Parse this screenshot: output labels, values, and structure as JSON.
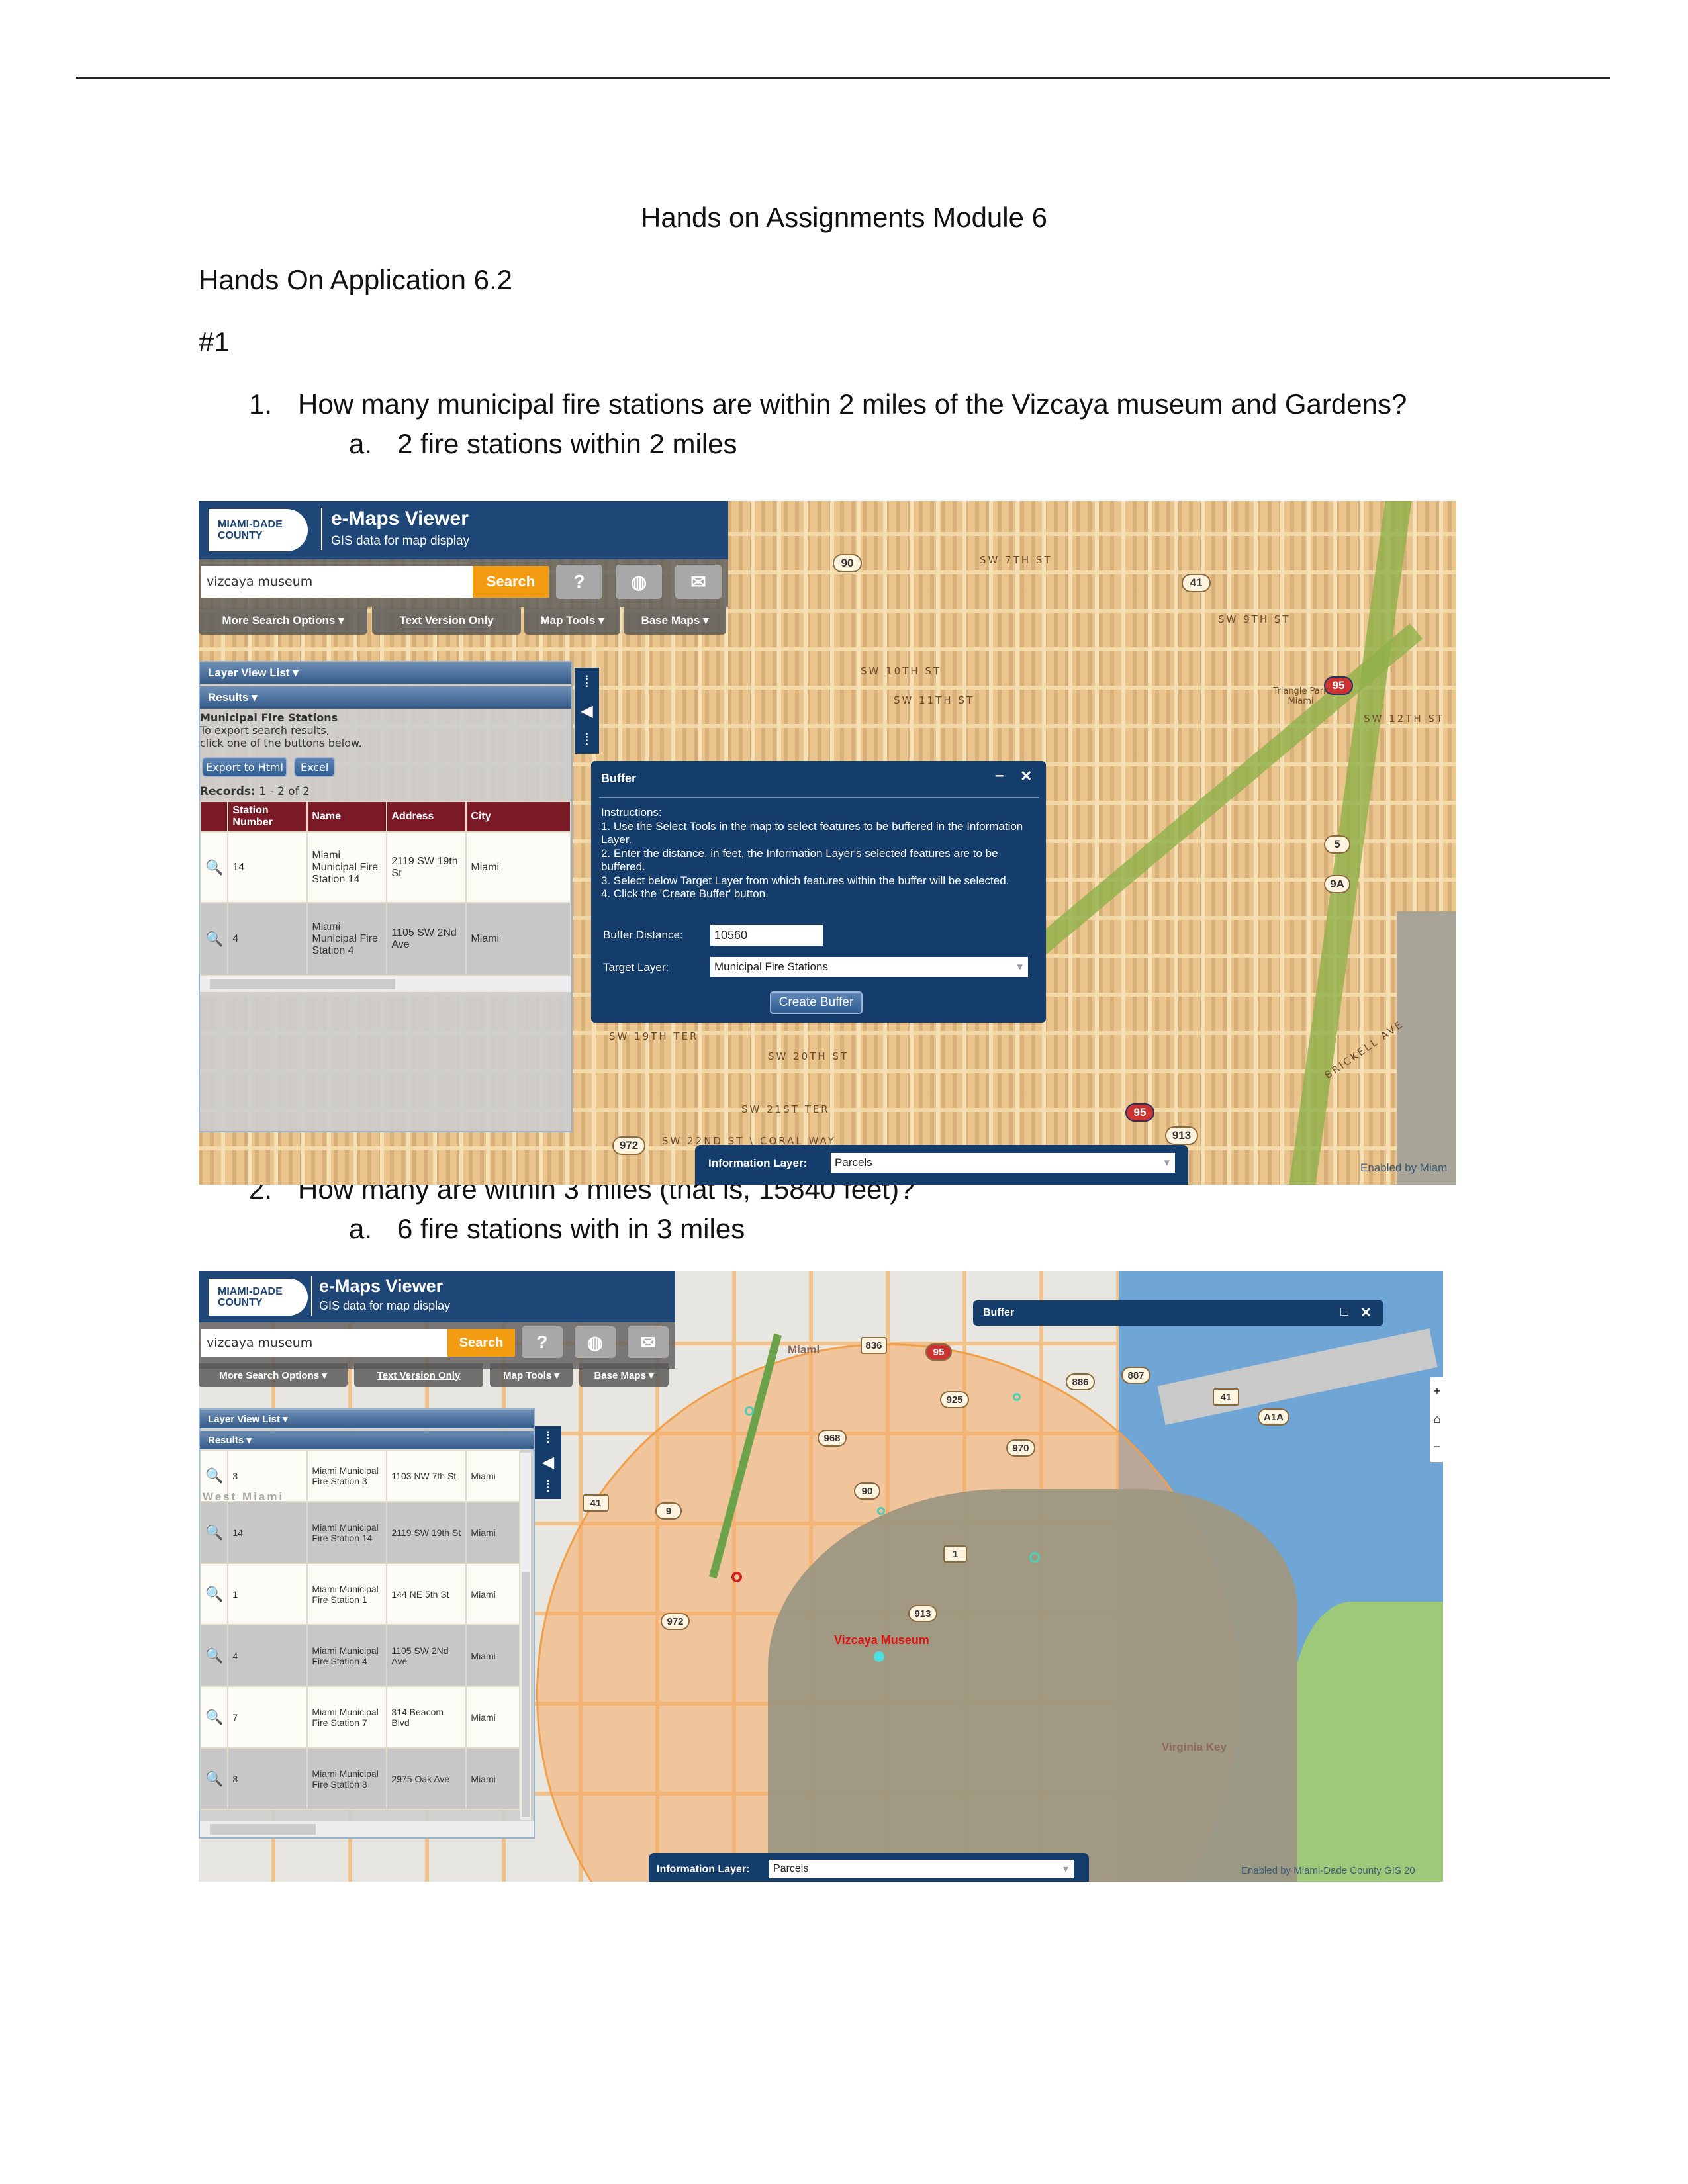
{
  "document": {
    "title": "Hands on Assignments Module 6",
    "section": "Hands On Application 6.2",
    "part": "#1",
    "questions": [
      {
        "number": "1.",
        "text": "How many municipal fire stations are within 2 miles of the Vizcaya museum and Gardens?",
        "answer_letter": "a.",
        "answer": "2 fire stations within 2 miles"
      },
      {
        "number": "2.",
        "text": "How many are within 3 miles (that is, 15840 feet)?",
        "answer_letter": "a.",
        "answer": "6 fire stations with in 3 miles"
      }
    ]
  },
  "app": {
    "logo_line1": "MIAMI-DADE",
    "logo_line2": "COUNTY",
    "title": "e-Maps Viewer",
    "subtitle": "GIS data for map display",
    "search_value": "vizcaya museum",
    "search_button": "Search",
    "icons": [
      "help-icon",
      "globe-icon",
      "mail-icon"
    ],
    "menus": [
      "More Search Options ▾",
      "Text Version Only",
      "Map Tools ▾",
      "Base Maps ▾"
    ],
    "layer_view_list": "Layer View List ▾",
    "results": "Results ▾",
    "information_layer_label": "Information Layer:",
    "information_layer_value": "Parcels",
    "attribution1": "Enabled by Miam",
    "attribution2": "Enabled by Miami-Dade County GIS 20",
    "colors": {
      "header": "#1e4677",
      "search": "#f39c12",
      "table_header": "#7a1a27",
      "buffer": "#f5b971"
    }
  },
  "screen1": {
    "results_title": "Municipal Fire Stations",
    "results_note1": "To export search results,",
    "results_note2": "click one of the buttons below.",
    "export_html": "Export to Html",
    "export_excel": "Excel",
    "records_label": "Records:",
    "records_value": "1 - 2 of 2",
    "columns": [
      "Station Number",
      "Name",
      "Address",
      "City"
    ],
    "rows": [
      {
        "num": "14",
        "name": "Miami Municipal Fire Station 14",
        "address": "2119 SW 19th St",
        "city": "Miami"
      },
      {
        "num": "4",
        "name": "Miami Municipal Fire Station 4",
        "address": "1105 SW 2Nd Ave",
        "city": "Miami"
      }
    ],
    "buffer": {
      "title": "Buffer",
      "minimize": "–",
      "close": "✕",
      "instructions_title": "Instructions:",
      "steps": [
        "1. Use the Select Tools in the map to select features to be buffered in the Information Layer.",
        "2. Enter the distance, in feet, the Information Layer's selected features are to be buffered.",
        "3. Select below Target Layer from which features within the buffer will be selected.",
        "4. Click the 'Create Buffer' button."
      ],
      "distance_label": "Buffer Distance:",
      "distance_value": "10560",
      "target_label": "Target Layer:",
      "target_value": "Municipal Fire Stations",
      "create_button": "Create Buffer"
    },
    "map_labels": {
      "shield_90": "90",
      "shield_41": "41",
      "shield_95a": "95",
      "shield_95b": "95",
      "shield_5": "5",
      "shield_9a": "9A",
      "shield_972": "972",
      "shield_913": "913",
      "sw7": "SW 7TH ST",
      "sw9": "SW 9TH ST",
      "sw10": "SW 10TH ST",
      "sw11": "SW 11TH ST",
      "sw12": "SW 12TH ST",
      "sw19": "SW 19TH TER",
      "sw20": "SW 20TH ST",
      "sw21": "SW 21ST TER",
      "coral": "SW 22ND ST \\ CORAL WAY",
      "brickell": "BRICKELL AVE",
      "triangle": "Triangle Park Miami"
    }
  },
  "screen2": {
    "rows": [
      {
        "num": "3",
        "name": "Miami Municipal Fire Station 3",
        "address": "1103 NW 7th St",
        "city": "Miami"
      },
      {
        "num": "14",
        "name": "Miami Municipal Fire Station 14",
        "address": "2119 SW 19th St",
        "city": "Miami"
      },
      {
        "num": "1",
        "name": "Miami Municipal Fire Station 1",
        "address": "144 NE 5th St",
        "city": "Miami"
      },
      {
        "num": "4",
        "name": "Miami Municipal Fire Station 4",
        "address": "1105 SW 2Nd Ave",
        "city": "Miami"
      },
      {
        "num": "7",
        "name": "Miami Municipal Fire Station 7",
        "address": "314 Beacom Blvd",
        "city": "Miami"
      },
      {
        "num": "8",
        "name": "Miami Municipal Fire Station 8",
        "address": "2975 Oak Ave",
        "city": "Miami"
      }
    ],
    "buffer_title": "Buffer",
    "map_labels": {
      "miami": "Miami",
      "vizcaya": "Vizcaya Museum",
      "virginia": "Virginia Key",
      "west_miami": "West Miami",
      "s836": "836",
      "s95": "95",
      "s925": "925",
      "s886": "886",
      "s887": "887",
      "s41a": "41",
      "sa1a": "A1A",
      "s968": "968",
      "s970": "970",
      "s90": "90",
      "s41b": "41",
      "s9": "9",
      "s1": "1",
      "s972": "972",
      "s913": "913"
    }
  }
}
